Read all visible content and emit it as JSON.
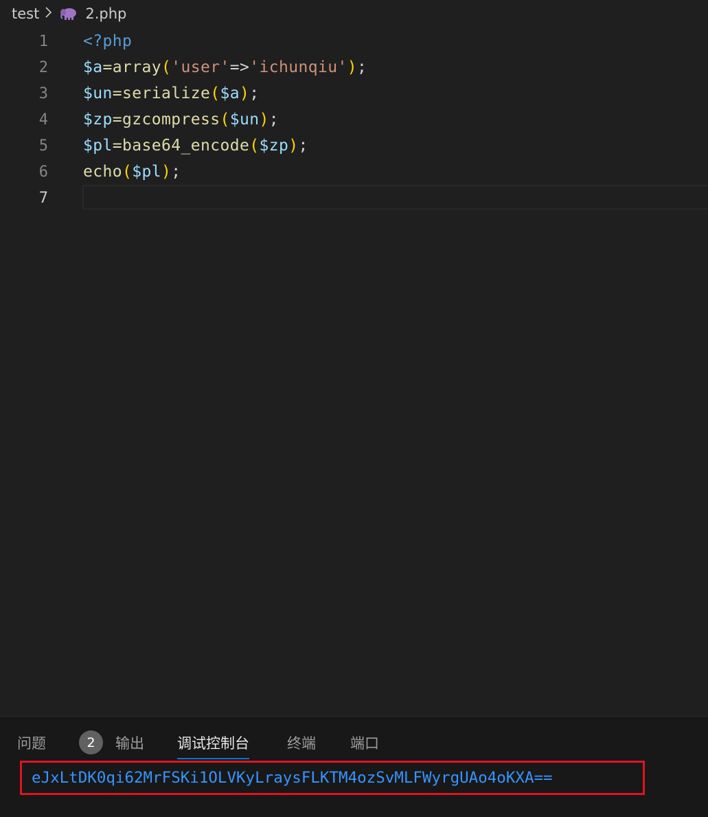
{
  "breadcrumb": {
    "folder": "test",
    "file": "2.php",
    "file_icon": "php-elephant-icon",
    "separator_icon": "chevron-right-icon"
  },
  "editor": {
    "active_line": 7,
    "lines": [
      {
        "number": "1",
        "tokens": [
          {
            "t": "<?php",
            "c": "kw"
          }
        ]
      },
      {
        "number": "2",
        "tokens": [
          {
            "t": "$a",
            "c": "var"
          },
          {
            "t": "=array",
            "c": "fn"
          },
          {
            "t": "(",
            "c": "br"
          },
          {
            "t": "'user'",
            "c": "str"
          },
          {
            "t": "=>",
            "c": "op"
          },
          {
            "t": "'ichunqiu'",
            "c": "str"
          },
          {
            "t": ")",
            "c": "br"
          },
          {
            "t": ";",
            "c": "op"
          }
        ]
      },
      {
        "number": "3",
        "tokens": [
          {
            "t": "$un",
            "c": "var"
          },
          {
            "t": "=serialize",
            "c": "fn"
          },
          {
            "t": "(",
            "c": "br"
          },
          {
            "t": "$a",
            "c": "var"
          },
          {
            "t": ")",
            "c": "br"
          },
          {
            "t": ";",
            "c": "op"
          }
        ]
      },
      {
        "number": "4",
        "tokens": [
          {
            "t": "$zp",
            "c": "var"
          },
          {
            "t": "=gzcompress",
            "c": "fn"
          },
          {
            "t": "(",
            "c": "br"
          },
          {
            "t": "$un",
            "c": "var"
          },
          {
            "t": ")",
            "c": "br"
          },
          {
            "t": ";",
            "c": "op"
          }
        ]
      },
      {
        "number": "5",
        "tokens": [
          {
            "t": "$pl",
            "c": "var"
          },
          {
            "t": "=base64_encode",
            "c": "fn"
          },
          {
            "t": "(",
            "c": "br"
          },
          {
            "t": "$zp",
            "c": "var"
          },
          {
            "t": ")",
            "c": "br"
          },
          {
            "t": ";",
            "c": "op"
          }
        ]
      },
      {
        "number": "6",
        "tokens": [
          {
            "t": "echo",
            "c": "fn"
          },
          {
            "t": "(",
            "c": "br"
          },
          {
            "t": "$pl",
            "c": "var"
          },
          {
            "t": ")",
            "c": "br"
          },
          {
            "t": ";",
            "c": "op"
          }
        ]
      },
      {
        "number": "7",
        "tokens": []
      }
    ]
  },
  "panel": {
    "tabs": [
      {
        "label": "问题",
        "active": false
      },
      {
        "label": "输出",
        "active": false
      },
      {
        "label": "调试控制台",
        "active": true
      },
      {
        "label": "终端",
        "active": false
      },
      {
        "label": "端口",
        "active": false
      }
    ],
    "problems_count": "2",
    "output": "eJxLtDK0qi62MrFSKi1OLVKyLraysFLKTM4ozSvMLFWyrgUAo4oKXA=="
  },
  "colors": {
    "keyword": "#569cd6",
    "variable": "#9cdcfe",
    "function": "#dcdcaa",
    "string": "#ce9178",
    "bracket": "#ffd700",
    "output_text": "#3794ff",
    "highlight_box": "#e0141e",
    "active_tab_underline": "#0078d4"
  }
}
